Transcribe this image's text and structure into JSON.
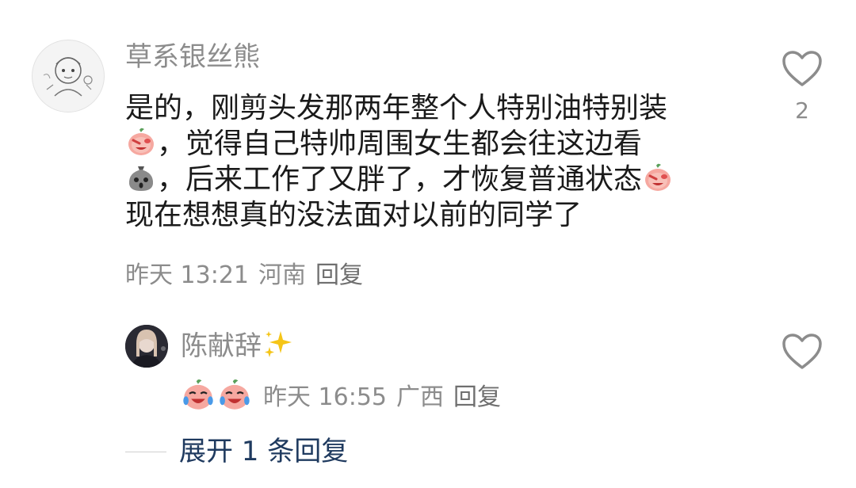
{
  "comment": {
    "username": "草系银丝熊",
    "lines": [
      {
        "text": "是的，刚剪头发那两年整个人特别油特别装",
        "emoji_before": "",
        "emoji_after": ""
      },
      {
        "text": "，觉得自己特帅周围女生都会往这边看",
        "emoji_before": "peach-facepalm",
        "emoji_after": ""
      },
      {
        "text": "，后来工作了又胖了，才恢复普通状态",
        "emoji_before": "sack-shocked",
        "emoji_after": "peach-facepalm"
      },
      {
        "text": "现在想想真的没法面对以前的同学了",
        "emoji_before": "",
        "emoji_after": ""
      }
    ],
    "time": "昨天 13:21",
    "location": "河南",
    "reply_label": "回复",
    "like_count": "2",
    "like_icon": "heart-outline-icon"
  },
  "reply": {
    "username": "陈献辞",
    "username_emoji": "sparkles",
    "emojis": [
      "peach-laugh-cry",
      "peach-laugh-cry"
    ],
    "time": "昨天 16:55",
    "location": "广西",
    "reply_label": "回复",
    "like_icon": "heart-outline-icon"
  },
  "expand": {
    "label": "展开 1 条回复"
  },
  "colors": {
    "meta": "#8c8c8c",
    "text": "#1a1a1a",
    "expand": "#1f3a5f"
  }
}
